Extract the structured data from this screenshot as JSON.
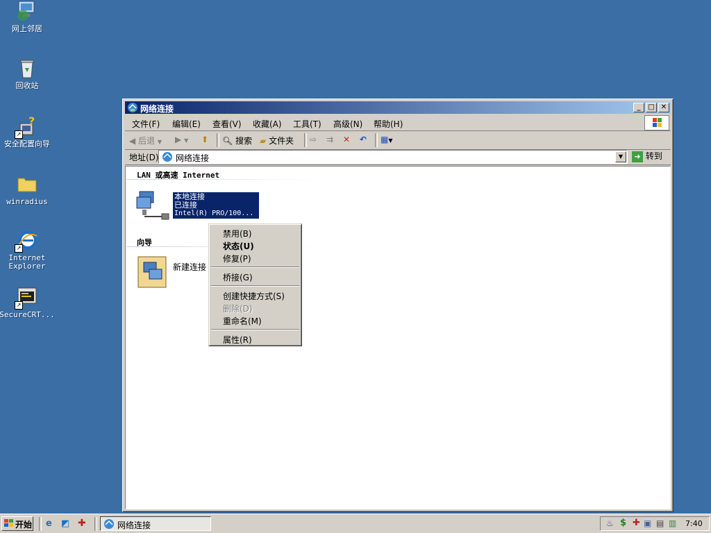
{
  "desktop": {
    "icons": [
      {
        "name": "网上邻居"
      },
      {
        "name": "回收站"
      },
      {
        "name": "安全配置向导"
      },
      {
        "name": "winradius"
      },
      {
        "name": "Internet Explorer"
      },
      {
        "name": "SecureCRT..."
      }
    ]
  },
  "window": {
    "title": "网络连接",
    "menu": [
      "文件(F)",
      "编辑(E)",
      "查看(V)",
      "收藏(A)",
      "工具(T)",
      "高级(N)",
      "帮助(H)"
    ],
    "toolbar": {
      "back": "后退",
      "search": "搜索",
      "folders": "文件夹"
    },
    "address": {
      "label": "地址(D)",
      "value": "网络连接",
      "go": "转到"
    },
    "groups": [
      {
        "header": "LAN 或高速 Internet"
      },
      {
        "header": "向导"
      }
    ],
    "connection": {
      "name": "本地连接",
      "status": "已连接",
      "device": "Intel(R) PRO/100..."
    },
    "wizard": {
      "label": "新建连接"
    }
  },
  "context_menu": {
    "items": [
      "禁用(B)",
      "状态(U)",
      "修复(P)",
      "桥接(G)",
      "创建快捷方式(S)",
      "删除(D)",
      "重命名(M)",
      "属性(R)"
    ]
  },
  "taskbar": {
    "start": "开始",
    "task": "网络连接",
    "clock": "7:40"
  }
}
